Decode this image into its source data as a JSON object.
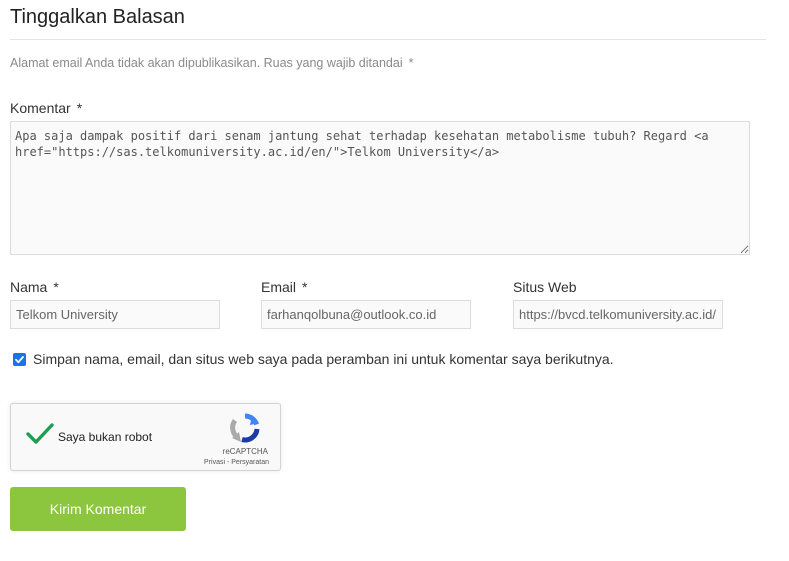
{
  "form": {
    "title": "Tinggalkan Balasan",
    "notes": "Alamat email Anda tidak akan dipublikasikan. Ruas yang wajib ditandai",
    "required_mark": "*",
    "comment": {
      "label": "Komentar",
      "value": "Apa saja dampak positif dari senam jantung sehat terhadap kesehatan metabolisme tubuh? Regard <a href=\"https://sas.telkomuniversity.ac.id/en/\">Telkom University</a>"
    },
    "name": {
      "label": "Nama",
      "value": "Telkom University"
    },
    "email": {
      "label": "Email",
      "value": "farhanqolbuna@outlook.co.id"
    },
    "website": {
      "label": "Situs Web",
      "value": "https://bvcd.telkomuniversity.ac.id/"
    },
    "save_checkbox": {
      "checked": true,
      "label": "Simpan nama, email, dan situs web saya pada peramban ini untuk komentar saya berikutnya."
    },
    "captcha": {
      "label": "Saya bukan robot",
      "brand": "reCAPTCHA",
      "terms": "Privasi - Persyaratan",
      "check_color": "#1e9e54"
    },
    "submit_label": "Kirim Komentar",
    "colors": {
      "submit_bg": "#8cc63e",
      "checkbox_bg": "#1a73e8"
    }
  }
}
